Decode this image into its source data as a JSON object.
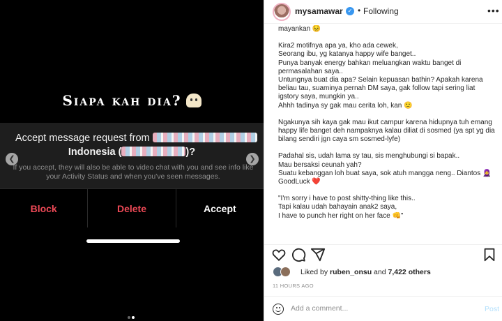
{
  "media": {
    "title": "Siapa kah dia?",
    "dialog": {
      "line1_prefix": "Accept message request from",
      "line2_prefix": "Indonesia (",
      "line2_suffix": ")?",
      "info": "If you accept, they will also be able to video chat with you and see info like your Activity Status and when you've seen messages."
    },
    "actions": {
      "block": "Block",
      "delete": "Delete",
      "accept": "Accept"
    },
    "carousel": {
      "total": 2,
      "active": 2
    }
  },
  "post": {
    "username": "mysamawar",
    "follow_status": "Following",
    "caption": [
      "mayankan 😣",
      "",
      "Kira2 motifnya apa ya, kho ada cewek,",
      "Seorang ibu, yg katanya happy wife banget..",
      "Punya banyak energy bahkan meluangkan waktu banget di permasalahan saya..",
      "Untungnya buat dia apa? Selain kepuasan bathin? Apakah karena beliau tau, suaminya pernah DM saya, gak follow tapi sering liat igstory saya, mungkin ya..",
      "Ahhh tadinya sy gak mau cerita loh, kan 🙁",
      "",
      "Ngakunya sih kaya gak mau ikut campur karena hidupnya tuh emang happy life banget deh nampaknya kalau diliat di sosmed (ya spt yg dia bilang sendiri jgn caya sm sosmed-lyfe)",
      "",
      "Padahal sis, udah lama sy tau, sis menghubungi si bapak..",
      "Mau bersaksi ceunah yah?",
      "Suatu kebanggan loh buat saya, sok atuh mangga neng.. Diantos 🧕",
      "GoodLuck ❤️",
      "",
      "\"I'm sorry i have to post shitty-thing like this..",
      "Tapi kalau udah bahayain anak2 saya,",
      "I have to punch her right on her face 👊\""
    ],
    "likes": {
      "prefix": "Liked by",
      "user": "ruben_onsu",
      "connector": "and",
      "others": "7,422 others"
    },
    "timestamp": "11 HOURS AGO",
    "comment": {
      "placeholder": "Add a comment...",
      "post_label": "Post"
    }
  },
  "colors": {
    "accent_blue": "#3897f0",
    "danger_red": "#ed4956",
    "post_disabled": "#b2dffc"
  }
}
